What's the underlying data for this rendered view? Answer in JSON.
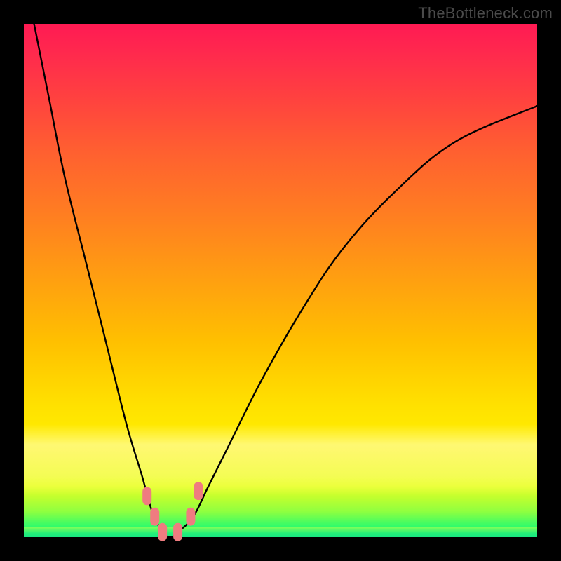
{
  "watermark": "TheBottleneck.com",
  "chart_data": {
    "type": "line",
    "title": "",
    "xlabel": "",
    "ylabel": "",
    "xlim": [
      0,
      100
    ],
    "ylim": [
      0,
      100
    ],
    "grid": false,
    "series": [
      {
        "name": "bottleneck-curve",
        "x": [
          2,
          5,
          8,
          12,
          16,
          20,
          23,
          25,
          27,
          28.5,
          30,
          33,
          36,
          40,
          46,
          54,
          62,
          72,
          84,
          100
        ],
        "values": [
          100,
          85,
          70,
          54,
          38,
          22,
          12,
          5,
          1,
          0,
          1,
          4,
          10,
          18,
          30,
          44,
          56,
          67,
          77,
          84
        ]
      }
    ],
    "markers": [
      {
        "x": 24.0,
        "y": 8
      },
      {
        "x": 25.5,
        "y": 4
      },
      {
        "x": 27.0,
        "y": 1
      },
      {
        "x": 30.0,
        "y": 1
      },
      {
        "x": 32.5,
        "y": 4
      },
      {
        "x": 34.0,
        "y": 9
      }
    ],
    "gradient_stops": [
      {
        "pos": 0,
        "color": "#ff1a53"
      },
      {
        "pos": 25,
        "color": "#ff6030"
      },
      {
        "pos": 50,
        "color": "#ffa010"
      },
      {
        "pos": 75,
        "color": "#ffe000"
      },
      {
        "pos": 95,
        "color": "#8fff40"
      },
      {
        "pos": 100,
        "color": "#18e882"
      }
    ]
  }
}
